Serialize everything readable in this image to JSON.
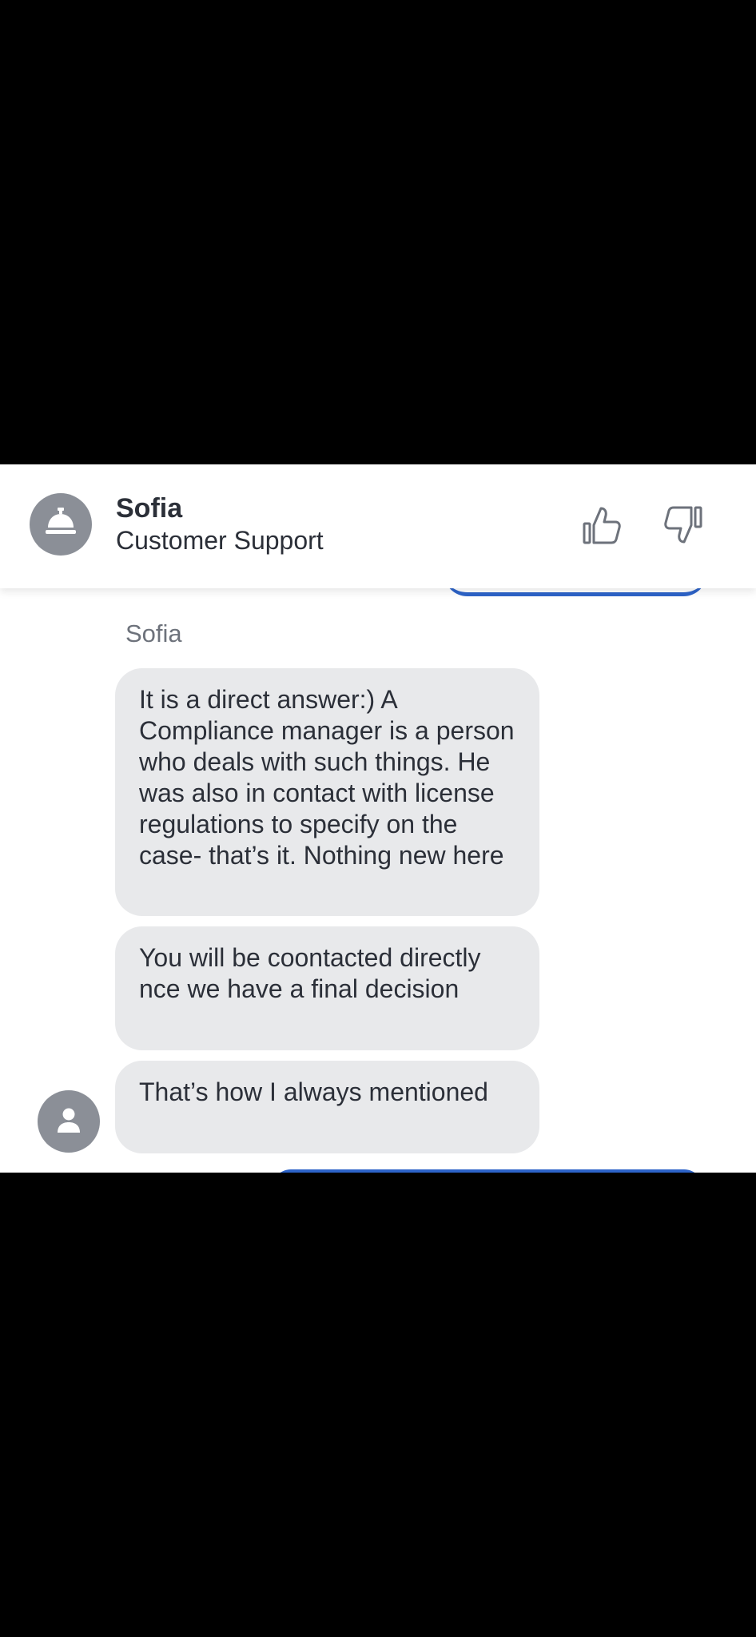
{
  "header": {
    "agent_name": "Sofia",
    "agent_role": "Customer Support",
    "avatar_icon": "service-bell-icon",
    "rate_up_icon": "thumbs-up-icon",
    "rate_down_icon": "thumbs-down-icon"
  },
  "conversation": {
    "sender_name": "Sofia",
    "messages": [
      {
        "text": "It is a direct answer:) A Compliance manager is a person who deals with such things. He was also in contact with license regulations to specify on the case- that’s it. Nothing new here"
      },
      {
        "text": "You will be coontacted directly nce we have a final decision"
      },
      {
        "text": "That’s how I always mentioned"
      }
    ],
    "sender_avatar_icon": "person-icon"
  },
  "colors": {
    "bubble_bg": "#e8e9eb",
    "text": "#2b2f38",
    "muted_text": "#6d727b",
    "avatar_bg": "#8b8f97",
    "accent_blue": "#2d63c8",
    "letterbox": "#000000"
  }
}
